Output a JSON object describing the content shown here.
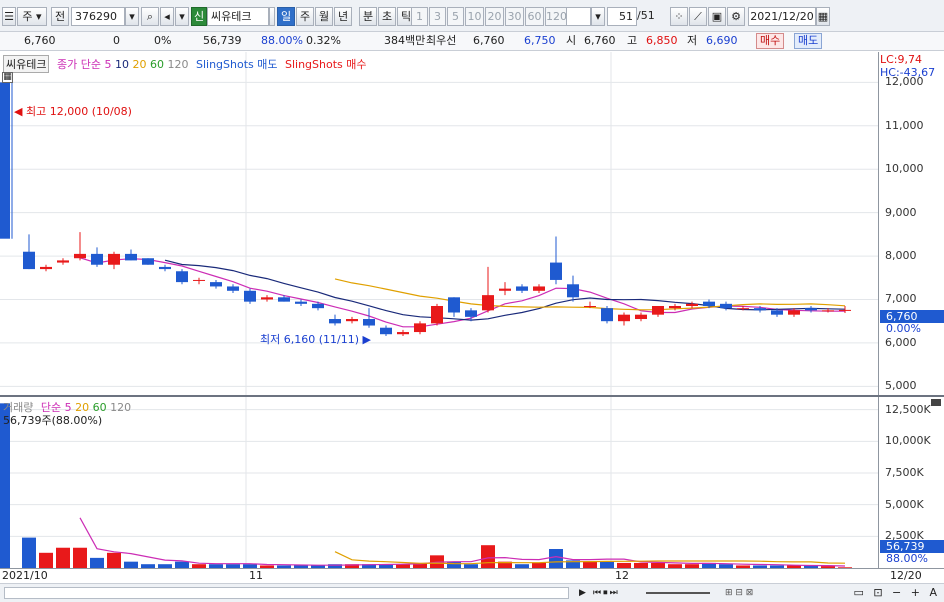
{
  "toolbar": {
    "market": "주",
    "type": "전",
    "code": "376290",
    "credit_badge": "신",
    "stock_name": "씨유테크",
    "periods": [
      "일",
      "주",
      "월",
      "년",
      "분",
      "초",
      "틱"
    ],
    "period_selected": "일",
    "intervals": [
      "1",
      "3",
      "5",
      "10",
      "20",
      "30",
      "60",
      "120"
    ],
    "count": "51",
    "count_total": "/51",
    "date": "2021/12/20"
  },
  "info": {
    "price": "6,760",
    "change": "0",
    "change_pct": "0%",
    "volume": "56,739",
    "vol_ratio": "88.00%",
    "turnover": "0.32%",
    "amount": "384백만",
    "best_ask_label": "최우선",
    "best_ask": "6,760",
    "best_bid": "6,750",
    "open_label": "시",
    "open": "6,760",
    "high_label": "고",
    "high": "6,850",
    "low_label": "저",
    "low": "6,690",
    "buy_label": "매수",
    "sell_label": "매도"
  },
  "price_panel": {
    "stock_label": "씨유테크",
    "ma_label": "종가 단순",
    "ma_periods": [
      "5",
      "10",
      "20",
      "60",
      "120"
    ],
    "sling_sell": "SlingShots 매도",
    "sling_buy": "SlingShots 매수",
    "lc": "LC:9,74",
    "hc": "HC:-43,67",
    "high_annotation": "최고 12,000 (10/08)",
    "low_annotation": "최저 6,160 (11/11)",
    "last_price_tag": "6,760",
    "last_pct_tag": "0.00%",
    "y_ticks": [
      "12,000",
      "11,000",
      "10,000",
      "9,000",
      "8,000",
      "7,000",
      "6,000",
      "5,000"
    ]
  },
  "volume_panel": {
    "label": "거래량",
    "ma_label": "단순",
    "ma_periods": [
      "5",
      "20",
      "60",
      "120"
    ],
    "info": "56,739주(88.00%)",
    "last_tag": "56,739",
    "last_pct_tag": "88.00%",
    "y_ticks": [
      "12,500K",
      "10,000K",
      "7,500K",
      "5,000K",
      "2,500K"
    ]
  },
  "x_axis": {
    "labels": [
      "2021/10",
      "11",
      "12"
    ],
    "end_label": "12/20"
  },
  "colors": {
    "up": "#e8191a",
    "down": "#1f5ad0",
    "ma5": "#cc2db5",
    "ma10": "#1a2a7a",
    "ma20": "#e0a000",
    "ma60": "#2a9d2a",
    "ma120": "#8a8a8a"
  },
  "chart_data": {
    "type": "candlestick",
    "y_range": [
      4800,
      12700
    ],
    "vol_range": [
      0,
      13500
    ],
    "candles": [
      {
        "o": 12000,
        "h": 12000,
        "l": 8400,
        "c": 8400,
        "v": 13000
      },
      {
        "o": 8100,
        "h": 8500,
        "l": 7700,
        "c": 7700,
        "v": 2400
      },
      {
        "o": 7700,
        "h": 7800,
        "l": 7650,
        "c": 7750,
        "v": 1200
      },
      {
        "o": 7850,
        "h": 7950,
        "l": 7800,
        "c": 7900,
        "v": 1600
      },
      {
        "o": 7950,
        "h": 8550,
        "l": 7900,
        "c": 8050,
        "v": 1600
      },
      {
        "o": 8050,
        "h": 8200,
        "l": 7750,
        "c": 7800,
        "v": 800
      },
      {
        "o": 7800,
        "h": 8100,
        "l": 7700,
        "c": 8050,
        "v": 1200
      },
      {
        "o": 8050,
        "h": 8150,
        "l": 7900,
        "c": 7900,
        "v": 500
      },
      {
        "o": 7950,
        "h": 7950,
        "l": 7800,
        "c": 7800,
        "v": 300
      },
      {
        "o": 7750,
        "h": 7800,
        "l": 7650,
        "c": 7700,
        "v": 300
      },
      {
        "o": 7650,
        "h": 7700,
        "l": 7350,
        "c": 7400,
        "v": 500
      },
      {
        "o": 7450,
        "h": 7500,
        "l": 7350,
        "c": 7450,
        "v": 300
      },
      {
        "o": 7400,
        "h": 7450,
        "l": 7250,
        "c": 7300,
        "v": 300
      },
      {
        "o": 7300,
        "h": 7350,
        "l": 7150,
        "c": 7200,
        "v": 300
      },
      {
        "o": 7200,
        "h": 7250,
        "l": 6900,
        "c": 6950,
        "v": 300
      },
      {
        "o": 7000,
        "h": 7100,
        "l": 6950,
        "c": 7050,
        "v": 200
      },
      {
        "o": 7050,
        "h": 7100,
        "l": 6950,
        "c": 6950,
        "v": 200
      },
      {
        "o": 6950,
        "h": 7000,
        "l": 6850,
        "c": 6900,
        "v": 200
      },
      {
        "o": 6900,
        "h": 6950,
        "l": 6750,
        "c": 6800,
        "v": 200
      },
      {
        "o": 6550,
        "h": 6650,
        "l": 6400,
        "c": 6450,
        "v": 300
      },
      {
        "o": 6500,
        "h": 6600,
        "l": 6450,
        "c": 6550,
        "v": 300
      },
      {
        "o": 6550,
        "h": 6800,
        "l": 6350,
        "c": 6400,
        "v": 300
      },
      {
        "o": 6350,
        "h": 6400,
        "l": 6160,
        "c": 6200,
        "v": 300
      },
      {
        "o": 6200,
        "h": 6300,
        "l": 6160,
        "c": 6250,
        "v": 300
      },
      {
        "o": 6250,
        "h": 6500,
        "l": 6200,
        "c": 6450,
        "v": 400
      },
      {
        "o": 6450,
        "h": 6900,
        "l": 6400,
        "c": 6850,
        "v": 1000
      },
      {
        "o": 7050,
        "h": 7050,
        "l": 6600,
        "c": 6700,
        "v": 500
      },
      {
        "o": 6750,
        "h": 6800,
        "l": 6500,
        "c": 6600,
        "v": 300
      },
      {
        "o": 6750,
        "h": 7750,
        "l": 6700,
        "c": 7100,
        "v": 1800
      },
      {
        "o": 7200,
        "h": 7400,
        "l": 7100,
        "c": 7250,
        "v": 500
      },
      {
        "o": 7300,
        "h": 7350,
        "l": 7150,
        "c": 7200,
        "v": 300
      },
      {
        "o": 7200,
        "h": 7350,
        "l": 7150,
        "c": 7300,
        "v": 400
      },
      {
        "o": 7850,
        "h": 8450,
        "l": 7350,
        "c": 7450,
        "v": 1500
      },
      {
        "o": 7350,
        "h": 7550,
        "l": 6950,
        "c": 7050,
        "v": 600
      },
      {
        "o": 6850,
        "h": 6950,
        "l": 6800,
        "c": 6850,
        "v": 500
      },
      {
        "o": 6800,
        "h": 6850,
        "l": 6450,
        "c": 6500,
        "v": 500
      },
      {
        "o": 6500,
        "h": 6700,
        "l": 6400,
        "c": 6650,
        "v": 400
      },
      {
        "o": 6550,
        "h": 6700,
        "l": 6500,
        "c": 6650,
        "v": 400
      },
      {
        "o": 6650,
        "h": 6850,
        "l": 6600,
        "c": 6850,
        "v": 400
      },
      {
        "o": 6800,
        "h": 6900,
        "l": 6750,
        "c": 6850,
        "v": 300
      },
      {
        "o": 6850,
        "h": 6950,
        "l": 6800,
        "c": 6900,
        "v": 300
      },
      {
        "o": 6950,
        "h": 7000,
        "l": 6800,
        "c": 6850,
        "v": 400
      },
      {
        "o": 6900,
        "h": 6950,
        "l": 6750,
        "c": 6800,
        "v": 300
      },
      {
        "o": 6800,
        "h": 6850,
        "l": 6750,
        "c": 6800,
        "v": 200
      },
      {
        "o": 6800,
        "h": 6850,
        "l": 6700,
        "c": 6750,
        "v": 200
      },
      {
        "o": 6750,
        "h": 6800,
        "l": 6600,
        "c": 6650,
        "v": 200
      },
      {
        "o": 6650,
        "h": 6800,
        "l": 6600,
        "c": 6750,
        "v": 200
      },
      {
        "o": 6800,
        "h": 6850,
        "l": 6700,
        "c": 6750,
        "v": 200
      },
      {
        "o": 6750,
        "h": 6800,
        "l": 6700,
        "c": 6750,
        "v": 150
      },
      {
        "o": 6760,
        "h": 6850,
        "l": 6690,
        "c": 6760,
        "v": 57
      }
    ]
  }
}
